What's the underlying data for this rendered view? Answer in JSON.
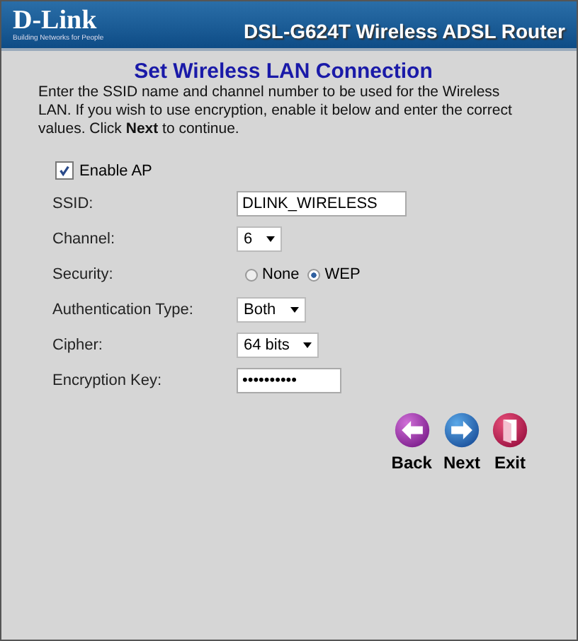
{
  "header": {
    "logo": "D-Link",
    "tagline": "Building Networks for People",
    "product": "DSL-G624T Wireless ADSL Router"
  },
  "title": "Set Wireless LAN Connection",
  "intro": "Enter the SSID name and channel number to be used for the Wireless LAN. If you wish to use encryption, enable it below and enter the correct values. Click **Next** to continue.",
  "enable_ap": {
    "label": "Enable AP",
    "checked": true
  },
  "fields": [
    {
      "kind": "text",
      "label": "SSID:",
      "value": "DLINK_WIRELESS"
    },
    {
      "kind": "select",
      "label": "Channel:",
      "value": "6"
    },
    {
      "kind": "radio",
      "label": "Security:",
      "options": [
        {
          "label": "None",
          "selected": false
        },
        {
          "label": "WEP",
          "selected": true
        }
      ]
    },
    {
      "kind": "select",
      "label": "Authentication Type:",
      "value": "Both"
    },
    {
      "kind": "select",
      "label": "Cipher:",
      "value": "64 bits"
    },
    {
      "kind": "password",
      "label": "Encryption Key:",
      "value": "••••••••••"
    }
  ],
  "buttons": [
    {
      "kind": "back",
      "label": "Back"
    },
    {
      "kind": "next",
      "label": "Next"
    },
    {
      "kind": "exit",
      "label": "Exit"
    }
  ]
}
